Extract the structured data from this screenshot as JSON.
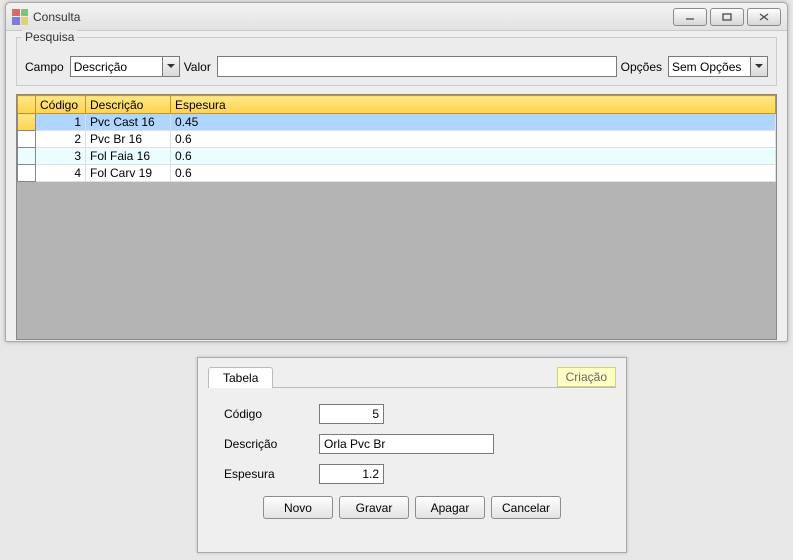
{
  "window": {
    "title": "Consulta"
  },
  "search": {
    "legend": "Pesquisa",
    "campo_label": "Campo",
    "campo_value": "Descrição",
    "valor_label": "Valor",
    "valor_value": "",
    "opcoes_label": "Opções",
    "opcoes_value": "Sem Opções"
  },
  "grid": {
    "columns": {
      "codigo": "Código",
      "descricao": "Descrição",
      "espesura": "Espesura"
    },
    "rows": [
      {
        "codigo": "1",
        "descricao": "Pvc Cast 16",
        "espesura": "0.45"
      },
      {
        "codigo": "2",
        "descricao": "Pvc Br 16",
        "espesura": "0.6"
      },
      {
        "codigo": "3",
        "descricao": "Fol Faia 16",
        "espesura": "0.6"
      },
      {
        "codigo": "4",
        "descricao": "Fol Carv 19",
        "espesura": "0.6"
      }
    ]
  },
  "form": {
    "tab_label": "Tabela",
    "mode_label": "Criação",
    "codigo_label": "Código",
    "codigo_value": "5",
    "descricao_label": "Descrição",
    "descricao_value": "Orla Pvc Br",
    "espesura_label": "Espesura",
    "espesura_value": "1.2",
    "buttons": {
      "novo": "Novo",
      "gravar": "Gravar",
      "apagar": "Apagar",
      "cancelar": "Cancelar"
    }
  }
}
